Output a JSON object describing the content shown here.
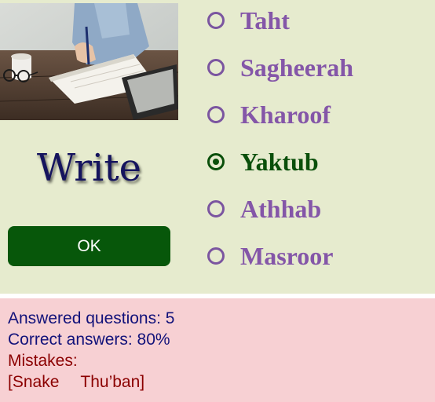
{
  "quiz": {
    "word": "Write",
    "ok_label": "OK",
    "options": [
      {
        "label": "Taht",
        "selected": false
      },
      {
        "label": "Sagheerah",
        "selected": false
      },
      {
        "label": "Kharoof",
        "selected": false
      },
      {
        "label": "Yaktub",
        "selected": true
      },
      {
        "label": "Athhab",
        "selected": false
      },
      {
        "label": "Masroor",
        "selected": false
      }
    ]
  },
  "stats": {
    "answered_label": "Answered questions: 5",
    "correct_label": "Correct answers: 80%",
    "mistakes_label": "Mistakes:",
    "mistakes_open": "[",
    "mistakes": [
      "Snake",
      "Thu’ban"
    ],
    "mistakes_close": "]"
  },
  "colors": {
    "panel_bg": "#e6ebce",
    "stats_bg": "#f7d0d3",
    "ok_button": "#07570a",
    "option_text": "#8456a8",
    "selected_text": "#0a4f0a",
    "word_text": "#15145e"
  }
}
